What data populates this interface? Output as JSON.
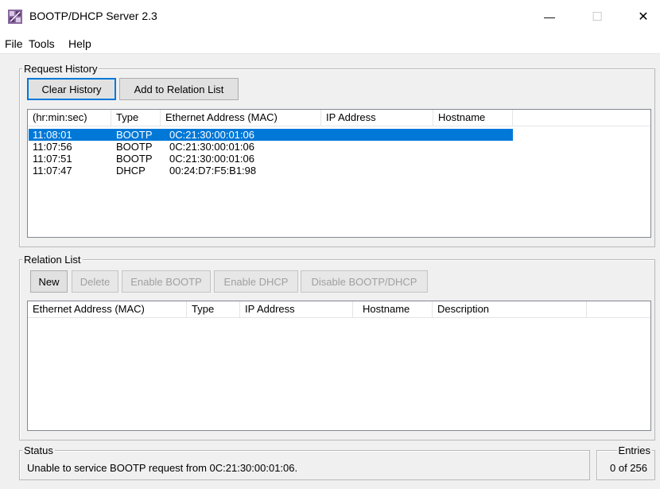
{
  "window": {
    "title": "BOOTP/DHCP Server 2.3",
    "minimize_glyph": "—",
    "maximize_glyph": "☐",
    "close_glyph": "✕"
  },
  "menu": {
    "items": [
      "File",
      "Tools",
      "Help"
    ]
  },
  "request_history": {
    "legend": "Request History",
    "clear_label": "Clear History",
    "add_label": "Add to Relation List",
    "columns": [
      "(hr:min:sec)",
      "Type",
      "Ethernet Address (MAC)",
      "IP Address",
      "Hostname"
    ],
    "rows": [
      {
        "time": "11:08:01",
        "type": "BOOTP",
        "mac": "0C:21:30:00:01:06",
        "ip": "",
        "hostname": "",
        "selected": true
      },
      {
        "time": "11:07:56",
        "type": "BOOTP",
        "mac": "0C:21:30:00:01:06",
        "ip": "",
        "hostname": "",
        "selected": false
      },
      {
        "time": "11:07:51",
        "type": "BOOTP",
        "mac": "0C:21:30:00:01:06",
        "ip": "",
        "hostname": "",
        "selected": false
      },
      {
        "time": "11:07:47",
        "type": "DHCP",
        "mac": "00:24:D7:F5:B1:98",
        "ip": "",
        "hostname": "",
        "selected": false
      }
    ]
  },
  "relation_list": {
    "legend": "Relation List",
    "new_label": "New",
    "delete_label": "Delete",
    "enable_bootp_label": "Enable BOOTP",
    "enable_dhcp_label": "Enable DHCP",
    "disable_label": "Disable BOOTP/DHCP",
    "columns": [
      "Ethernet Address (MAC)",
      "Type",
      "IP Address",
      "Hostname",
      "Description"
    ]
  },
  "status": {
    "legend": "Status",
    "message": "Unable to service BOOTP request from 0C:21:30:00:01:06."
  },
  "entries": {
    "legend": "Entries",
    "value": "0 of 256"
  },
  "colors": {
    "selection": "#0078d7",
    "face": "#f0f0f0"
  }
}
